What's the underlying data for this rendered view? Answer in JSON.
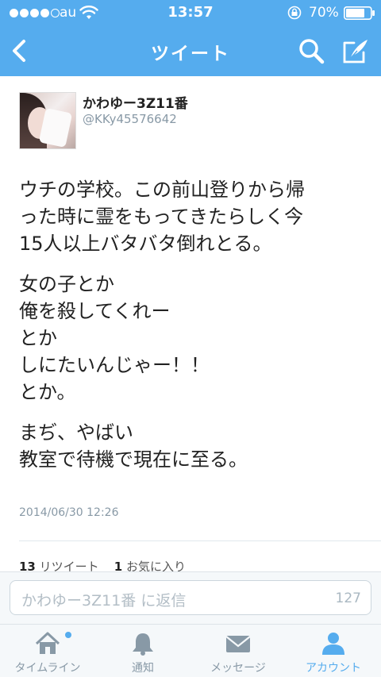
{
  "colors": {
    "accent": "#55acee",
    "muted": "#8899a6"
  },
  "status_bar": {
    "carrier": "au",
    "time": "13:57",
    "battery": "70%",
    "icons": [
      "signal-dots",
      "wifi-icon",
      "rotation-lock-icon",
      "battery-icon"
    ]
  },
  "nav": {
    "title": "ツイート",
    "icons": [
      "back-icon",
      "search-icon",
      "compose-icon"
    ]
  },
  "tweet": {
    "author": {
      "display_name": "かわゆー3Z11番",
      "screen_name": "@KKy45576642"
    },
    "paragraphs": [
      [
        "ウチの学校。この前山登りから帰",
        "った時に霊をもってきたらしく今",
        "15人以上バタバタ倒れとる。"
      ],
      [
        "女の子とか",
        "俺を殺してくれー",
        "とか",
        "しにたいんじゃー！！",
        "とか。"
      ],
      [
        "まぢ、やばい",
        "教室で待機で現在に至る。"
      ]
    ],
    "timestamp": "2014/06/30 12:26",
    "stats": {
      "retweets_count": "13",
      "retweets_label": "リツイート",
      "favorites_count": "1",
      "favorites_label": "お気に入り"
    }
  },
  "reply": {
    "placeholder": "かわゆー3Z11番 に返信",
    "char_count": "127"
  },
  "tabs": [
    {
      "label": "タイムライン",
      "icon": "home-icon"
    },
    {
      "label": "通知",
      "icon": "bell-icon"
    },
    {
      "label": "メッセージ",
      "icon": "envelope-icon"
    },
    {
      "label": "アカウント",
      "icon": "person-icon"
    }
  ]
}
